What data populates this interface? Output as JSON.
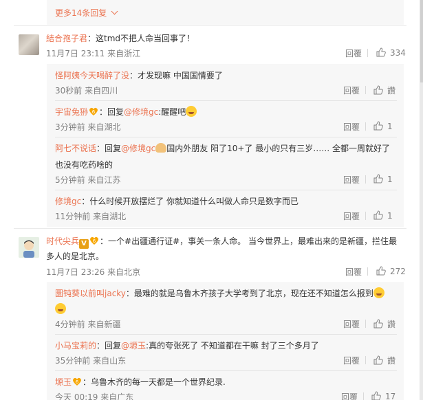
{
  "more_replies": "更多14条回复",
  "labels": {
    "reply": "回覆",
    "like_placeholder": "讚"
  },
  "comments": [
    {
      "username": "結合孢子君",
      "text": "：这tmd不把人命当回事了！",
      "meta": "11月7日 23:11 来自浙江",
      "likes": "334"
    },
    {
      "username": "时代尖兵",
      "text_line1": "：一个#出疆通行证#，事关一条人命。 当今世界上，最难出来的是新疆，拦住最",
      "text_line2": "多人的是北京。",
      "meta": "11月7日 23:26 来自北京",
      "likes": "272"
    }
  ],
  "replies_a": [
    {
      "username": "怪阿姨今天喝醉了没",
      "text": "：才发现嘛 中国国情要了",
      "meta": "30秒前 来自四川",
      "likes": "讚"
    },
    {
      "username": "宇宙兔狲",
      "text_prefix": "：回复",
      "mention": "@修境gc",
      "text": ":醒醒吧",
      "meta": "3分钟前 来自湖北",
      "likes": "1"
    },
    {
      "username": "阿七不说话",
      "text_prefix": "：回复",
      "mention": "@修境gc",
      "text": "国内外朋友 阳了10+了 最小的只有三岁…… 全都一周就好了",
      "text_line2": "也没有吃药啥的",
      "meta": "5分钟前 来自江苏",
      "likes": "1"
    },
    {
      "username": "修境gc",
      "text": "：什么时候开放摆烂了 你就知道什么叫做人命只是数字而已",
      "meta": "11分钟前 来自湖北",
      "likes": "1"
    }
  ],
  "replies_b": [
    {
      "username": "圜钝葵以前叫jacky",
      "text": "：最难的就是乌鲁木齐孩子大学考到了北京，现在还不知道怎么报到",
      "meta": "4分钟前 来自新疆",
      "likes": "讚"
    },
    {
      "username": "小马宝莉的",
      "text_prefix": "：回复",
      "mention": "@塬玉",
      "text": ":真的夸张死了 不知道都在干嘛 封了三个多月了",
      "meta": "35分钟前 来自山东",
      "likes": "讚"
    },
    {
      "username": "塬玉",
      "text": "：乌鲁木齐的每一天都是一个世界纪录.",
      "meta": "今天 00:19 来自广东",
      "likes": "17"
    }
  ],
  "colors": {
    "accent": "#eb7350",
    "meta": "#808080",
    "text": "#333333"
  }
}
